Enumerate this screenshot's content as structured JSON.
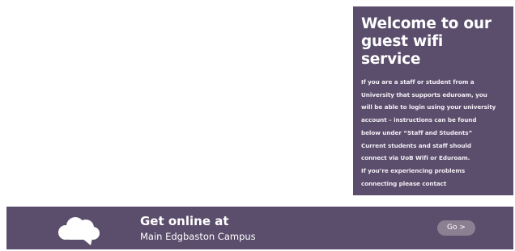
{
  "welcome": {
    "title": "Welcome to our\nguest wifi service",
    "body": "If you are a staff or student from a\nUniversity that supports eduroam, you\nwill be able to login using your university\naccount – instructions can be found\nbelow under “Staff and Students”\nCurrent students and staff should\nconnect via UoB Wifi or Eduroam.\nIf you’re experiencing problems\nconnecting please contact"
  },
  "online": {
    "title": "Get online at",
    "campus": "Main Edgbaston Campus",
    "icon": "cloud-speech-icon",
    "go_label": "Go >"
  },
  "colors": {
    "panel_bg": "#5b4e6c",
    "button_bg": "#8a8092",
    "text": "#ffffff"
  }
}
